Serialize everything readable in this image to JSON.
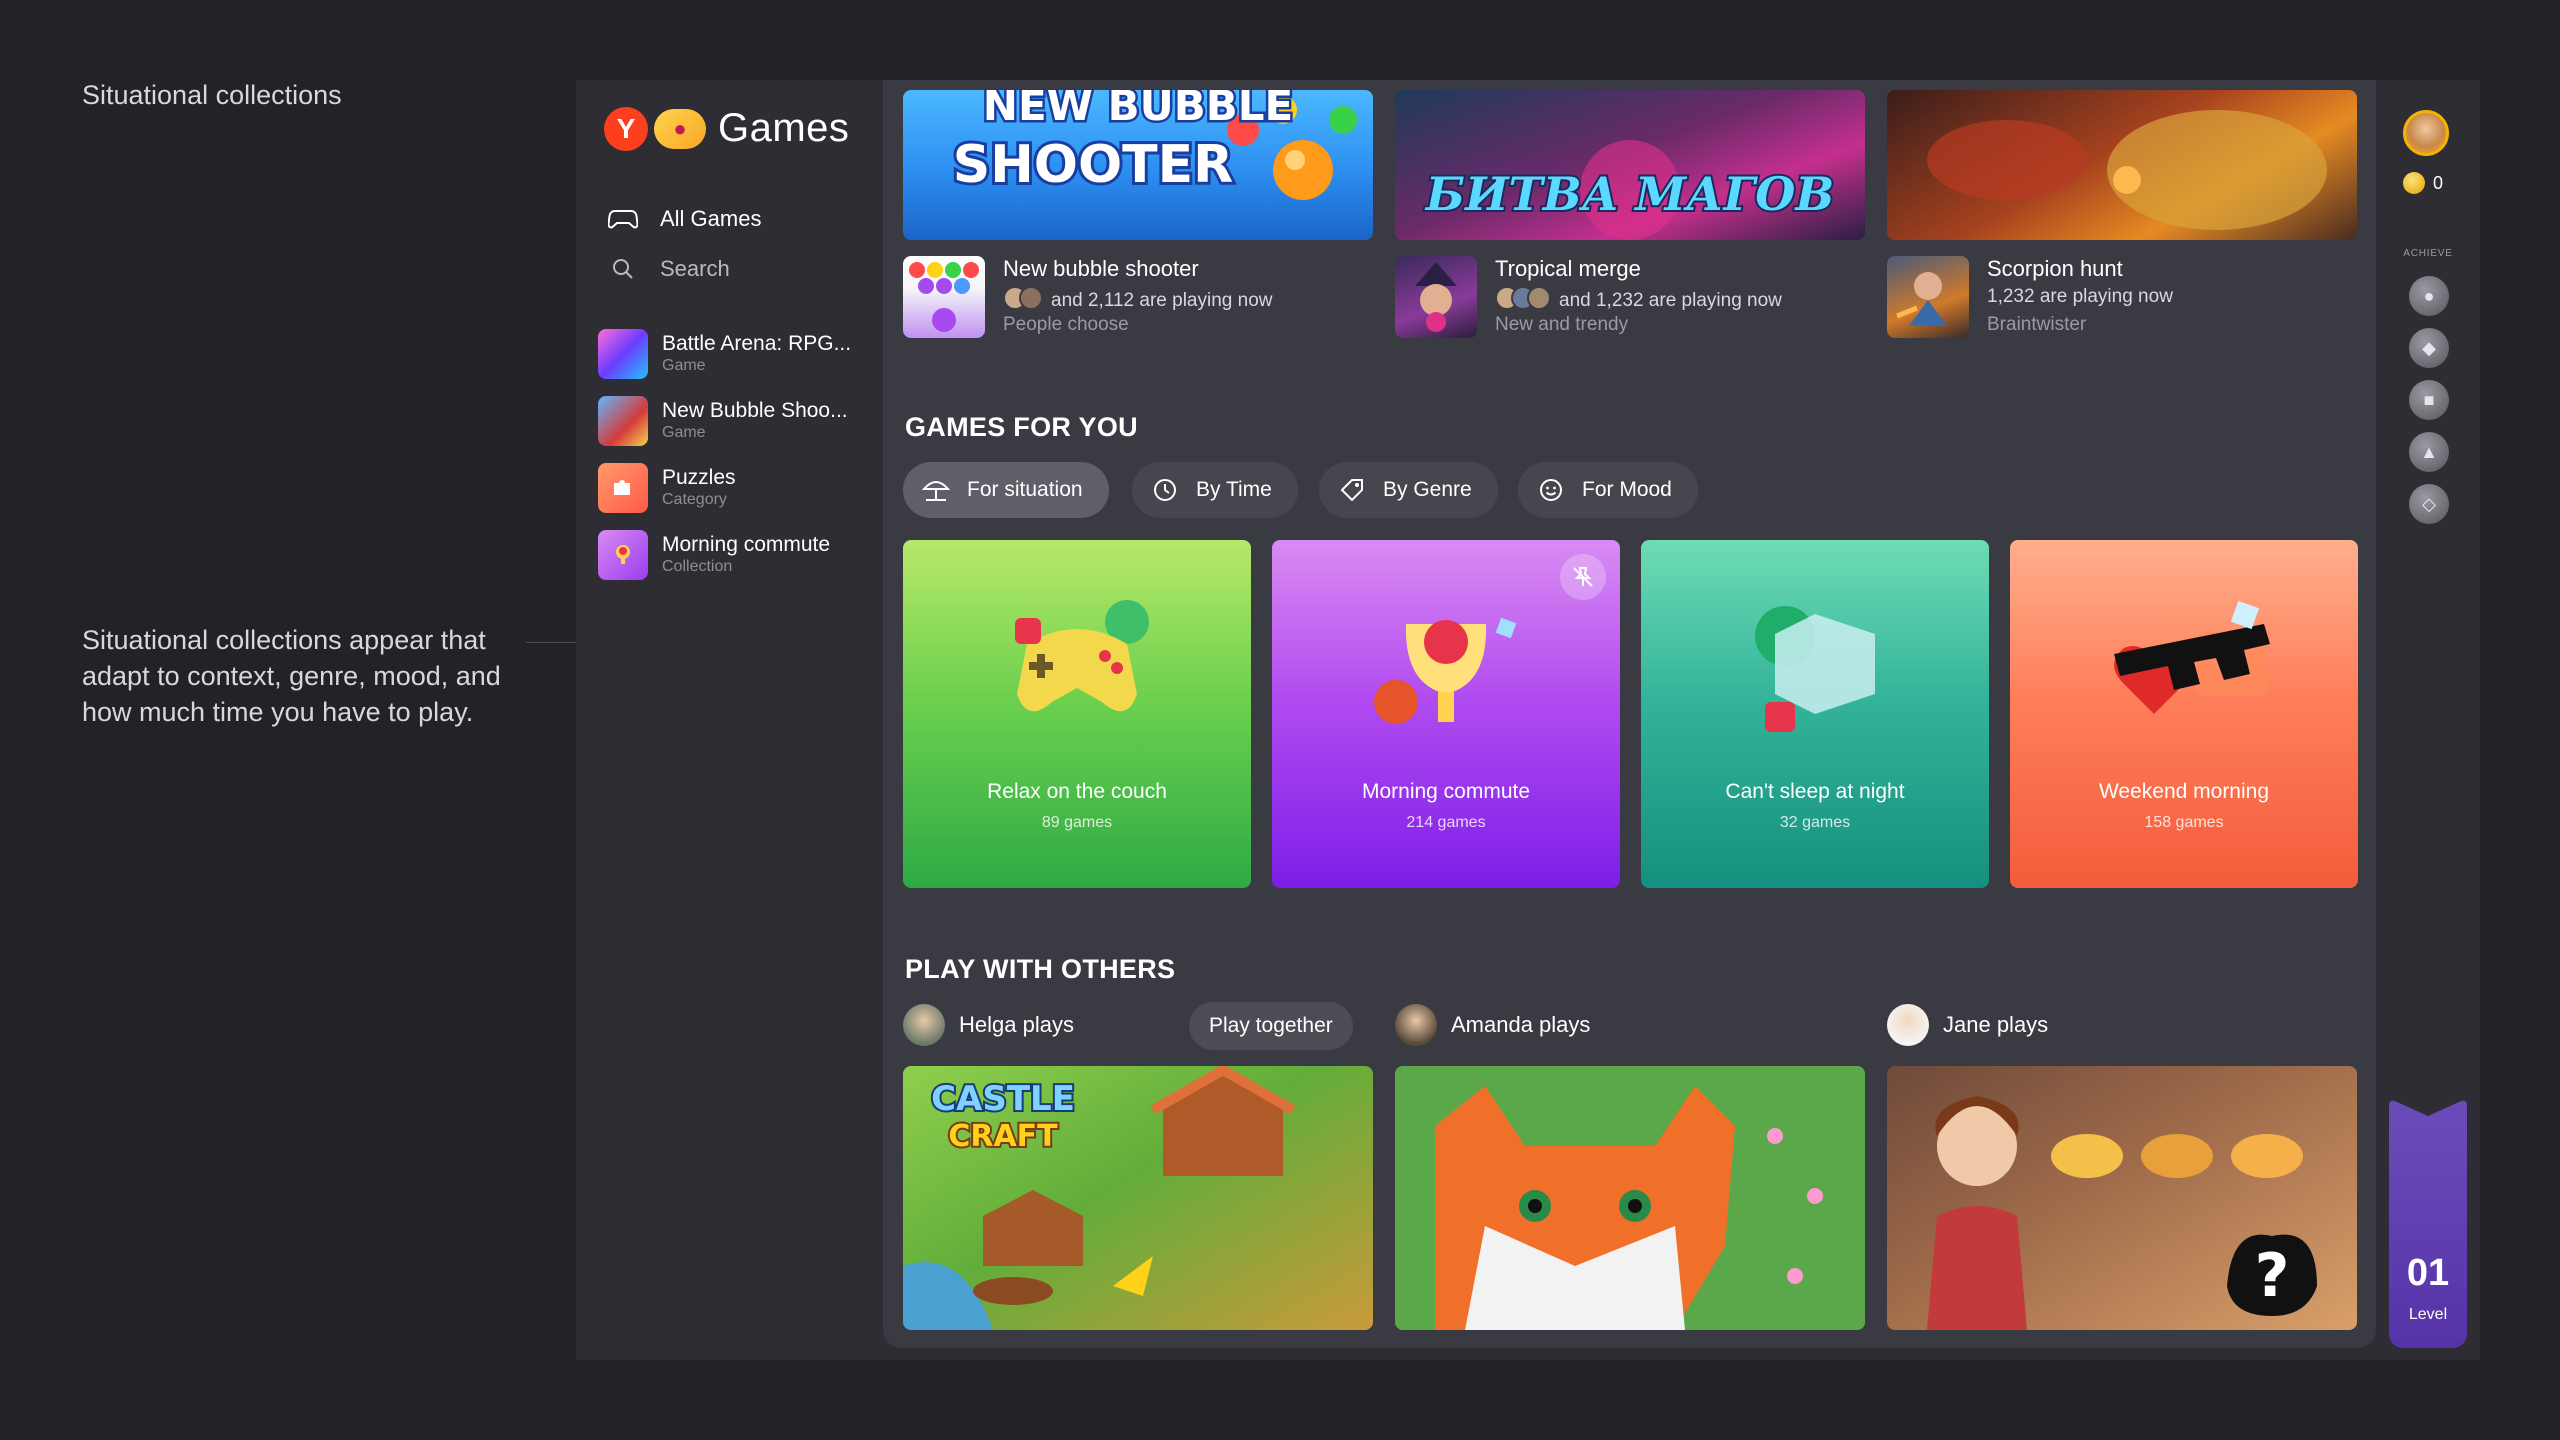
{
  "captions": {
    "title": "Situational collections",
    "body": "Situational collections appear that adapt to context, genre, mood, and how much time you have to play."
  },
  "app": {
    "logo_text": "Games",
    "nav": {
      "all_games": "All Games",
      "search": "Search"
    },
    "recent": [
      {
        "title": "Battle Arena: RPG...",
        "sub": "Game"
      },
      {
        "title": "New Bubble Shoo...",
        "sub": "Game"
      },
      {
        "title": "Puzzles",
        "sub": "Category"
      },
      {
        "title": "Morning commute",
        "sub": "Collection"
      }
    ]
  },
  "featured": [
    {
      "banner_text": "NEW BUBBLE SHOOTER",
      "title": "New bubble shooter",
      "players": "and 2,112 are playing now",
      "tag": "People choose"
    },
    {
      "banner_text": "БИТВА МАГОВ",
      "title": "Tropical merge",
      "players": "and 1,232 are playing now",
      "tag": "New and trendy"
    },
    {
      "banner_text": "",
      "title": "Scorpion hunt",
      "players": "1,232 are playing now",
      "tag": "Braintwister"
    }
  ],
  "games_for_you": {
    "title": "GAMES FOR YOU",
    "chips": [
      {
        "label": "For situation",
        "icon": "beach-umbrella-icon",
        "active": true
      },
      {
        "label": "By Time",
        "icon": "clock-icon",
        "active": false
      },
      {
        "label": "By Genre",
        "icon": "tag-icon",
        "active": false
      },
      {
        "label": "For Mood",
        "icon": "smiley-icon",
        "active": false
      }
    ],
    "collections": [
      {
        "title": "Relax on the couch",
        "count": "89 games",
        "icon": "gamepad-icon"
      },
      {
        "title": "Morning commute",
        "count": "214 games",
        "icon": "trophy-icon"
      },
      {
        "title": "Can't sleep at night",
        "count": "32 games",
        "icon": "dice-icon"
      },
      {
        "title": "Weekend morning",
        "count": "158 games",
        "icon": "pixel-sunglasses-icon"
      }
    ]
  },
  "play_with_others": {
    "title": "PLAY WITH OTHERS",
    "play_together": "Play together",
    "players": [
      {
        "name": "Helga plays",
        "game_text": "CASTLE CRAFT"
      },
      {
        "name": "Amanda plays",
        "game_text": ""
      },
      {
        "name": "Jane plays",
        "game_text": "?"
      }
    ]
  },
  "rail": {
    "coins": "0",
    "achieve_label": "ACHIEVE",
    "achievements": [
      "bomb-icon",
      "shield-icon",
      "puzzle-icon",
      "car-icon",
      "dice-icon"
    ],
    "level_number": "01",
    "level_label": "Level"
  },
  "colors": {
    "page_bg": "#222328",
    "app_bg": "#2d2d33",
    "main_bg": "#3a3a42",
    "brand_red": "#fc3f1d",
    "level_purple": "#5533a8"
  }
}
